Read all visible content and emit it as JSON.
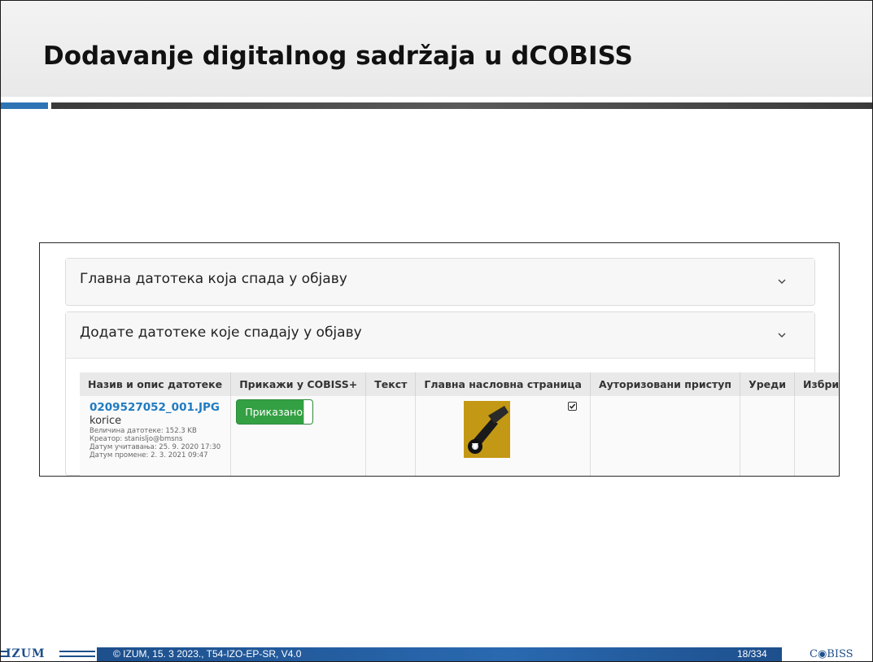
{
  "slide": {
    "title": "Dodavanje digitalnog sadržaja u dCOBISS"
  },
  "panels": {
    "main_file_title": "Главна датотека која спада у објаву",
    "added_files_title": "Додате датотеке које спадају у објаву"
  },
  "table": {
    "headers": {
      "name": "Назив и опис датотеке",
      "show": "Прикажи у COBISS+",
      "text": "Текст",
      "main_title_page": "Главна насловна страница",
      "authorized_access": "Ауторизовани приступ",
      "edit": "Уреди",
      "delete": "Избриши"
    },
    "rows": [
      {
        "file_name": "0209527052_001.JPG",
        "description": "korice",
        "size": "Величина датотеке: 152.3 KB",
        "creator": "Креатор: stanisljo@bmsns",
        "uploaded": "Датум учитавања: 25. 9. 2020 17:30",
        "modified": "Датум промене: 2. 3. 2021 09:47",
        "show_status": "Приказано"
      }
    ]
  },
  "footer": {
    "logo": "IZUM",
    "copyright": "© IZUM, 15. 3 2023., T54-IZO-EP-SR, V4.0",
    "page": "18/334",
    "brand": "C◉BISS"
  },
  "colors": {
    "accent_blue": "#2e74b5",
    "link_blue": "#1f7bc1",
    "toggle_green": "#34a044",
    "footer_blue": "#1d4f8c"
  }
}
